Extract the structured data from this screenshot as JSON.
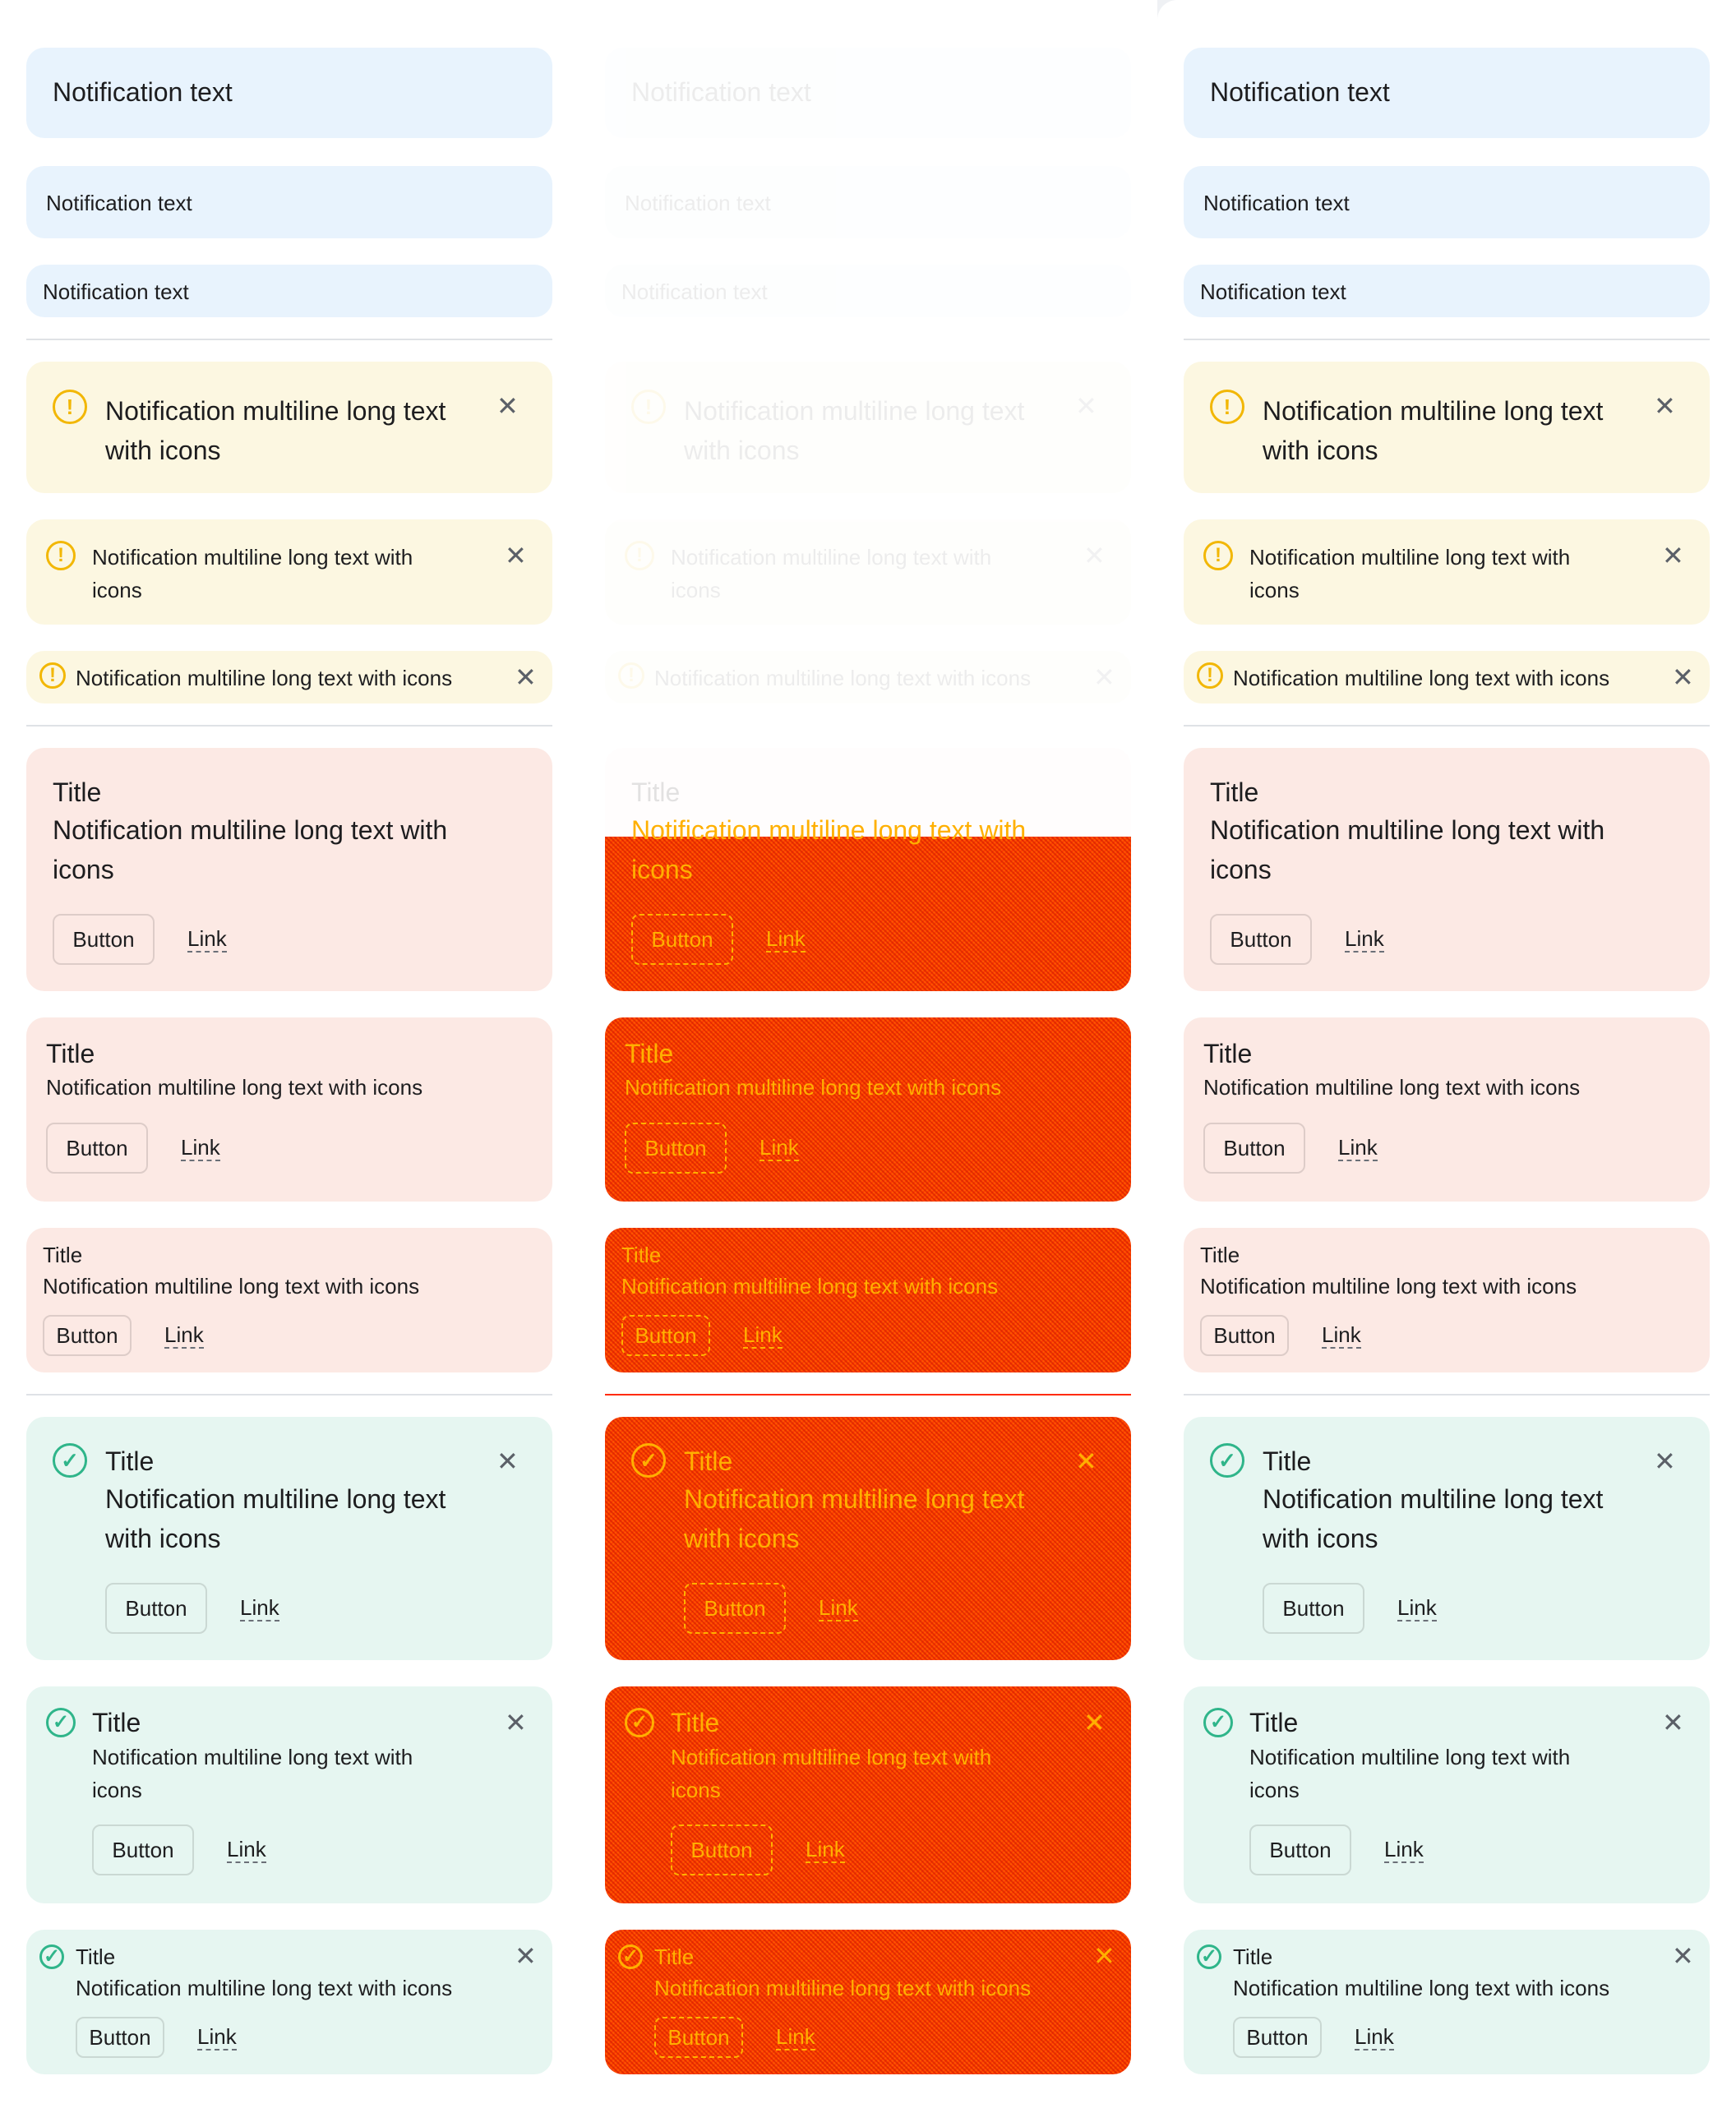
{
  "notification_text": "Notification text",
  "warning_text_wrap_lg": "Notification multiline long text\nwith icons",
  "warning_text_wrap_md": "Notification multiline long text with\nicons",
  "warning_text_single": "Notification multiline long text with icons",
  "error_title": "Title",
  "error_text_wrap": "Notification multiline long text with\nicons",
  "error_text_single": "Notification multiline long text with icons",
  "success_title": "Title",
  "success_text_wrap_lg": "Notification multiline long text\nwith icons",
  "success_text_wrap_md": "Notification multiline long text with\nicons",
  "success_text_single": "Notification multiline long text with icons",
  "button_label": "Button",
  "link_label": "Link",
  "icons": {
    "warning": "alert-circle-icon",
    "success": "check-circle-icon",
    "close": "close-icon"
  },
  "glyphs": {
    "warning": "!",
    "success": "✓",
    "close": "✕"
  },
  "colors": {
    "info_bg": "#e8f3fd",
    "warning_bg": "#fcf7e1",
    "error_bg": "#fce9e4",
    "success_bg": "#e6f6f1",
    "warning_accent": "#f2b705",
    "success_accent": "#2fb58a",
    "highlight": "#ff3d00"
  }
}
